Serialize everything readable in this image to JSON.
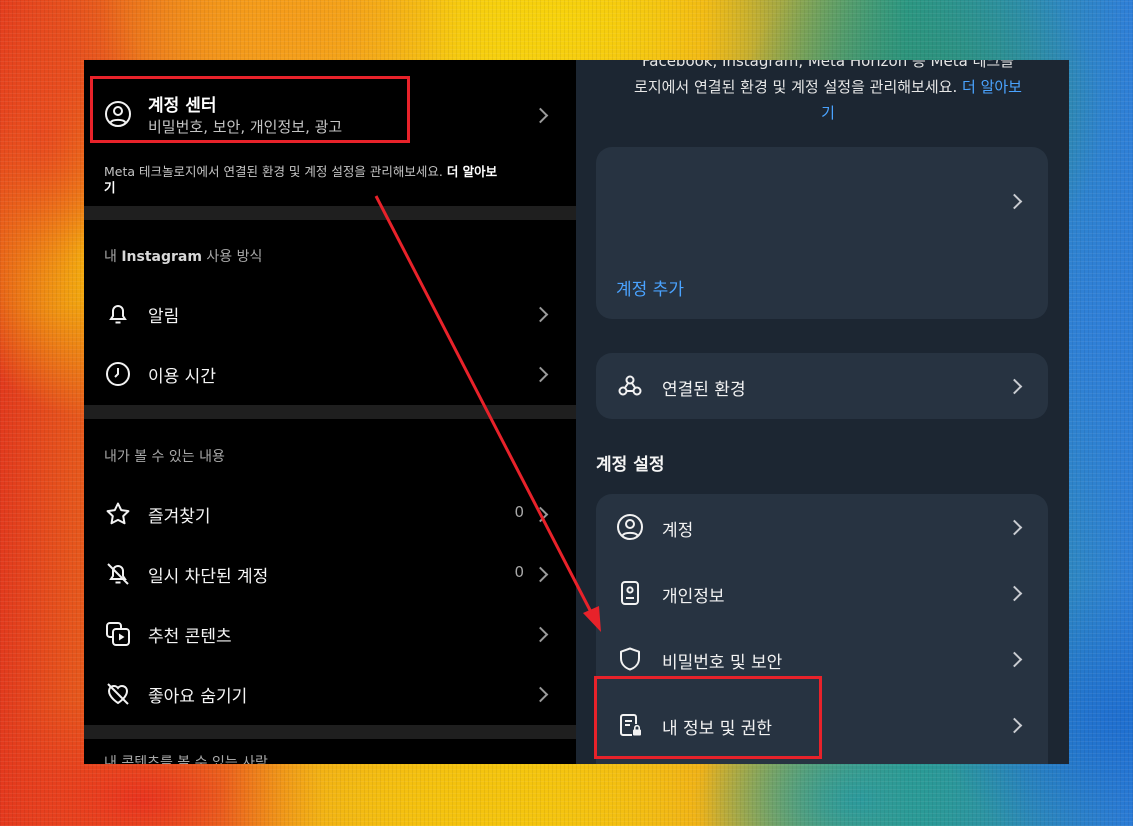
{
  "left_panel": {
    "account_center": {
      "title": "계정 센터",
      "subtitle": "비밀번호, 보안, 개인정보, 광고"
    },
    "meta_note": {
      "text": "Meta 테크놀로지에서 연결된 환경 및 계정 설정을 관리해보세요.",
      "link": "더 알아보",
      "link_wrap": "기"
    },
    "section_usage": {
      "prefix": "내",
      "brand": "Instagram",
      "suffix": "사용 방식",
      "items": [
        {
          "label": "알림",
          "icon": "bell-icon"
        },
        {
          "label": "이용 시간",
          "icon": "clock-icon"
        }
      ]
    },
    "section_content": {
      "header": "내가 볼 수 있는 내용",
      "items": [
        {
          "label": "즐겨찾기",
          "count": "0",
          "icon": "star-icon"
        },
        {
          "label": "일시 차단된 계정",
          "count": "0",
          "icon": "muted-bell-icon"
        },
        {
          "label": "추천 콘텐츠",
          "icon": "suggested-content-icon"
        },
        {
          "label": "좋아요 숨기기",
          "icon": "heart-off-icon"
        }
      ]
    },
    "section_cut": {
      "header": "내 콘텐츠를 볼 수 있는 사람"
    }
  },
  "right_panel": {
    "top_text_line1": "Facebook, Instagram, Meta Horizon 등 Meta 테크놀",
    "top_text_line2": "로지에서 연결된 환경 및 계정 설정을 관리해보세요.",
    "learn_more_a": "더 알아보",
    "learn_more_b": "기",
    "add_account": "계정 추가",
    "connected": "연결된 환경",
    "settings_header": "계정 설정",
    "settings_items": [
      {
        "label": "계정",
        "icon": "person-circle-icon"
      },
      {
        "label": "개인정보",
        "icon": "id-badge-icon"
      },
      {
        "label": "비밀번호 및 보안",
        "icon": "shield-icon"
      },
      {
        "label": "내 정보 및 권한",
        "icon": "document-lock-icon"
      }
    ]
  },
  "colors": {
    "highlight": "#e8222a",
    "link_blue": "#4aa3ff",
    "left_bg": "#000000",
    "right_bg": "#1c2632"
  }
}
